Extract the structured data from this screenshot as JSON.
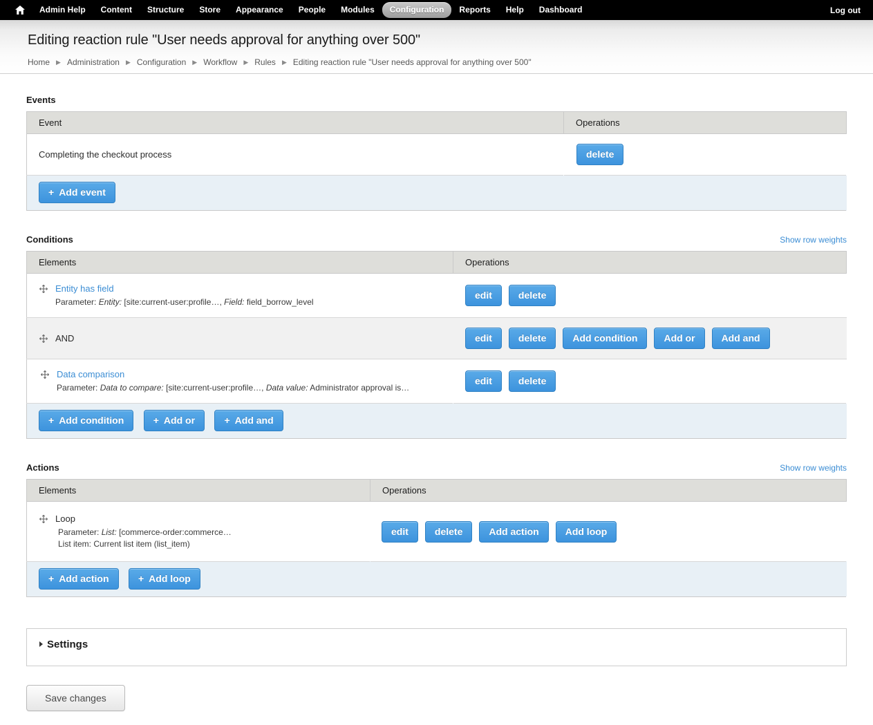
{
  "toolbar": {
    "home_icon": "home-icon",
    "items": [
      {
        "label": "Admin Help",
        "active": false
      },
      {
        "label": "Content",
        "active": false
      },
      {
        "label": "Structure",
        "active": false
      },
      {
        "label": "Store",
        "active": false
      },
      {
        "label": "Appearance",
        "active": false
      },
      {
        "label": "People",
        "active": false
      },
      {
        "label": "Modules",
        "active": false
      },
      {
        "label": "Configuration",
        "active": true
      },
      {
        "label": "Reports",
        "active": false
      },
      {
        "label": "Help",
        "active": false
      },
      {
        "label": "Dashboard",
        "active": false
      }
    ],
    "logout": "Log out"
  },
  "header": {
    "title": "Editing reaction rule \"User needs approval for anything over 500\"",
    "breadcrumb": [
      "Home",
      "Administration",
      "Configuration",
      "Workflow",
      "Rules",
      "Editing reaction rule \"User needs approval for anything over 500\""
    ]
  },
  "events": {
    "label": "Events",
    "columns": [
      "Event",
      "Operations"
    ],
    "rows": [
      {
        "event": "Completing the checkout process",
        "operations": [
          {
            "label": "delete",
            "name": "delete-button"
          }
        ]
      }
    ],
    "footer_buttons": [
      {
        "label": "Add event",
        "plus": "+",
        "name": "add-event-button"
      }
    ]
  },
  "conditions": {
    "label": "Conditions",
    "show_row_weights": "Show row weights",
    "columns": [
      "Elements",
      "Operations"
    ],
    "rows": [
      {
        "title": "Entity has field",
        "is_link": true,
        "indent": 0,
        "shaded": false,
        "param_prefix": "Parameter:",
        "param_parts": [
          {
            "text": "Entity:",
            "italic": true
          },
          {
            "text": "[site:current-user:profile…,",
            "italic": false
          },
          {
            "text": "Field:",
            "italic": true
          },
          {
            "text": "field_borrow_level",
            "italic": false
          }
        ],
        "operations": [
          {
            "label": "edit",
            "name": "edit-button"
          },
          {
            "label": "delete",
            "name": "delete-button"
          }
        ]
      },
      {
        "title": "AND",
        "is_link": false,
        "indent": 0,
        "shaded": true,
        "param_prefix": "",
        "param_parts": [],
        "operations": [
          {
            "label": "edit",
            "name": "edit-button"
          },
          {
            "label": "delete",
            "name": "delete-button"
          },
          {
            "label": "Add condition",
            "name": "add-condition-button"
          },
          {
            "label": "Add or",
            "name": "add-or-button"
          },
          {
            "label": "Add and",
            "name": "add-and-button"
          }
        ]
      },
      {
        "title": "Data comparison",
        "is_link": true,
        "indent": 1,
        "shaded": false,
        "param_prefix": "Parameter:",
        "param_parts": [
          {
            "text": "Data to compare:",
            "italic": true
          },
          {
            "text": "[site:current-user:profile…,",
            "italic": false
          },
          {
            "text": "Data value:",
            "italic": true
          },
          {
            "text": "Administrator approval is…",
            "italic": false
          }
        ],
        "operations": [
          {
            "label": "edit",
            "name": "edit-button"
          },
          {
            "label": "delete",
            "name": "delete-button"
          }
        ]
      }
    ],
    "footer_buttons": [
      {
        "label": "Add condition",
        "plus": "+",
        "name": "add-condition-button"
      },
      {
        "label": "Add or",
        "plus": "+",
        "name": "add-or-button"
      },
      {
        "label": "Add and",
        "plus": "+",
        "name": "add-and-button"
      }
    ]
  },
  "actions": {
    "label": "Actions",
    "show_row_weights": "Show row weights",
    "columns": [
      "Elements",
      "Operations"
    ],
    "rows": [
      {
        "title": "Loop",
        "is_link": false,
        "param_line1_prefix": "Parameter:",
        "param_line1_italic": "List:",
        "param_line1_rest": "[commerce-order:commerce…",
        "param_line2": "List item: Current list item (list_item)",
        "operations": [
          {
            "label": "edit",
            "name": "edit-button"
          },
          {
            "label": "delete",
            "name": "delete-button"
          },
          {
            "label": "Add action",
            "name": "add-action-button"
          },
          {
            "label": "Add loop",
            "name": "add-loop-button"
          }
        ]
      }
    ],
    "footer_buttons": [
      {
        "label": "Add action",
        "plus": "+",
        "name": "add-action-button"
      },
      {
        "label": "Add loop",
        "plus": "+",
        "name": "add-loop-button"
      }
    ]
  },
  "settings": {
    "legend": "Settings"
  },
  "save": {
    "label": "Save changes"
  },
  "colors": {
    "toolbar_bg": "#000000",
    "accent_blue": "#3b8dd4",
    "button_blue": "#59aae8",
    "header_row": "#dededa",
    "add_row_bg": "#e8f0f6",
    "shaded_row": "#f1f1f1"
  }
}
